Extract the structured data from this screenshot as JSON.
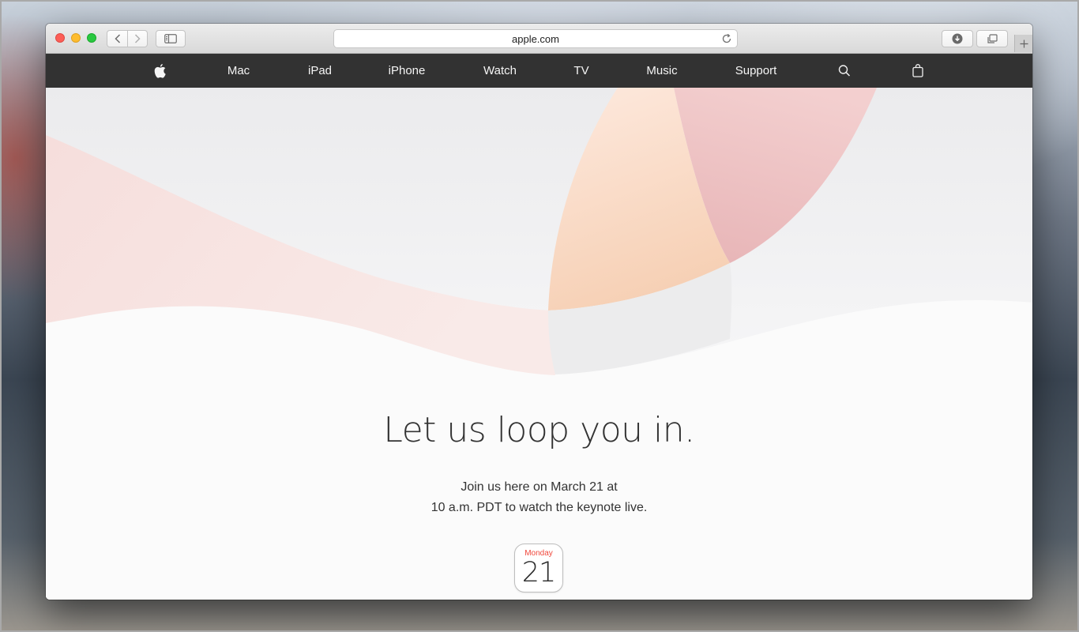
{
  "browser": {
    "address": "apple.com"
  },
  "nav": {
    "items": [
      "Mac",
      "iPad",
      "iPhone",
      "Watch",
      "TV",
      "Music",
      "Support"
    ]
  },
  "hero": {
    "headline": "Let us loop you in.",
    "line1": "Join us here on March 21 at",
    "line2": "10 a.m. PDT to watch the keynote live.",
    "calendar_day": "Monday",
    "calendar_date": "21"
  },
  "colors": {
    "nav_bg": "#323232",
    "calendar_day": "#f0473b"
  }
}
